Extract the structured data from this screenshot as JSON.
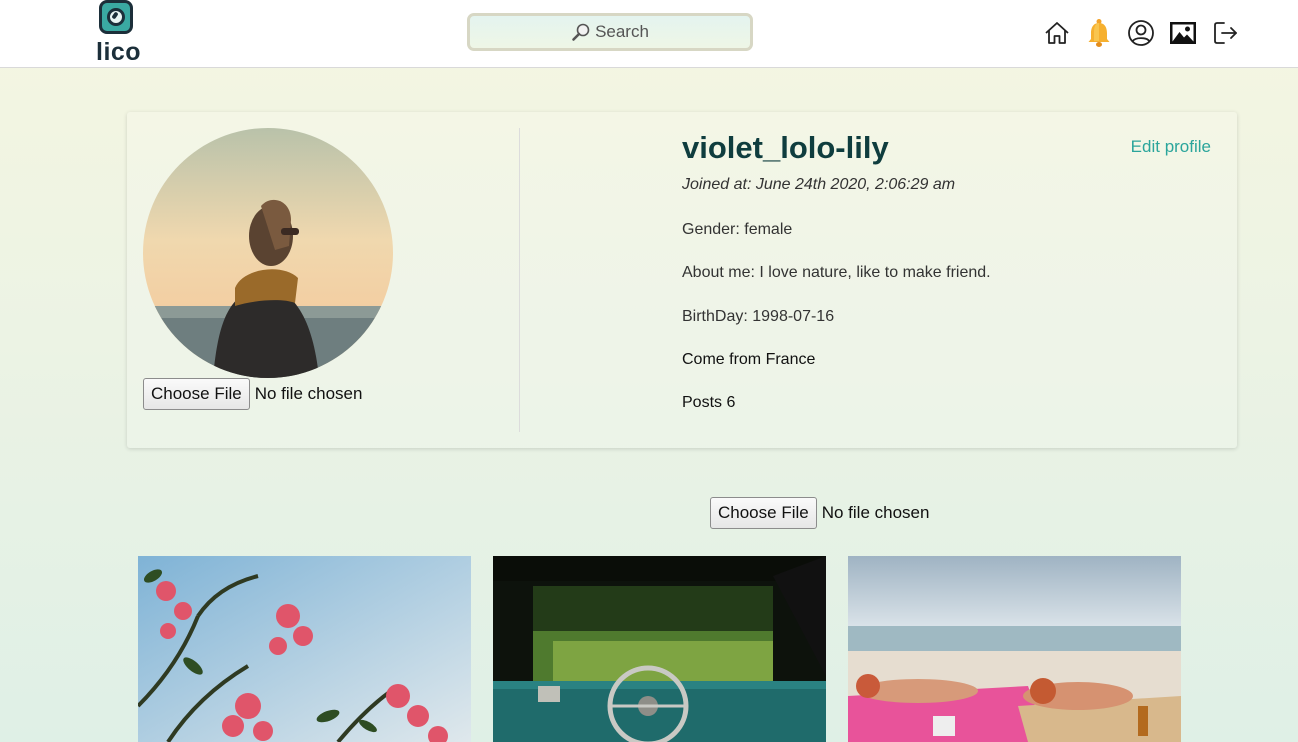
{
  "header": {
    "logo_text": "lico",
    "search_placeholder": "Search",
    "nav": [
      {
        "icon": "home-icon"
      },
      {
        "icon": "bell-icon"
      },
      {
        "icon": "user-circle-icon"
      },
      {
        "icon": "image-icon"
      },
      {
        "icon": "logout-icon"
      }
    ]
  },
  "profile": {
    "username": "violet_lolo-lily",
    "edit_label": "Edit profile",
    "joined": "Joined at: June 24th 2020, 2:06:29 am",
    "gender": "Gender: female",
    "about": "About me: I love nature, like to make friend.",
    "birthday": "BirthDay: 1998-07-16",
    "come_from": "Come from France",
    "posts": "Posts 6",
    "avatar_upload": {
      "button": "Choose File",
      "status": "No file chosen"
    }
  },
  "post_upload": {
    "button": "Choose File",
    "status": "No file chosen"
  },
  "gallery": [
    {
      "subject": "pink-flowers-sky"
    },
    {
      "subject": "vintage-car-dashboard"
    },
    {
      "subject": "beach-sunbathers"
    }
  ],
  "colors": {
    "accent": "#2aa59b",
    "username": "#0f3d3e",
    "logo_dark": "#1c2f3a",
    "logo_teal": "#3aa9a2"
  }
}
